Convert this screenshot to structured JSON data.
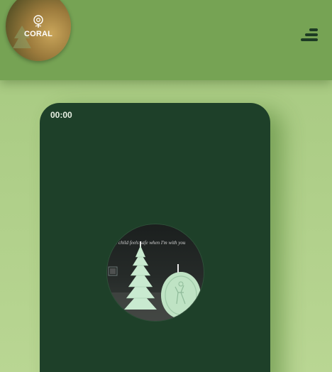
{
  "header": {
    "brand": "CORAL",
    "menu_icon": "hamburger-menu-icon"
  },
  "player": {
    "elapsed": "00:00",
    "thumbnail_caption": "ce child feels safe when I'm with you"
  },
  "colors": {
    "header_bg": "#76a354",
    "page_bg": "#b3d18c",
    "card_bg": "#1e4029",
    "menu_icon": "#1d3b24",
    "candle": "#bfe3c4"
  }
}
